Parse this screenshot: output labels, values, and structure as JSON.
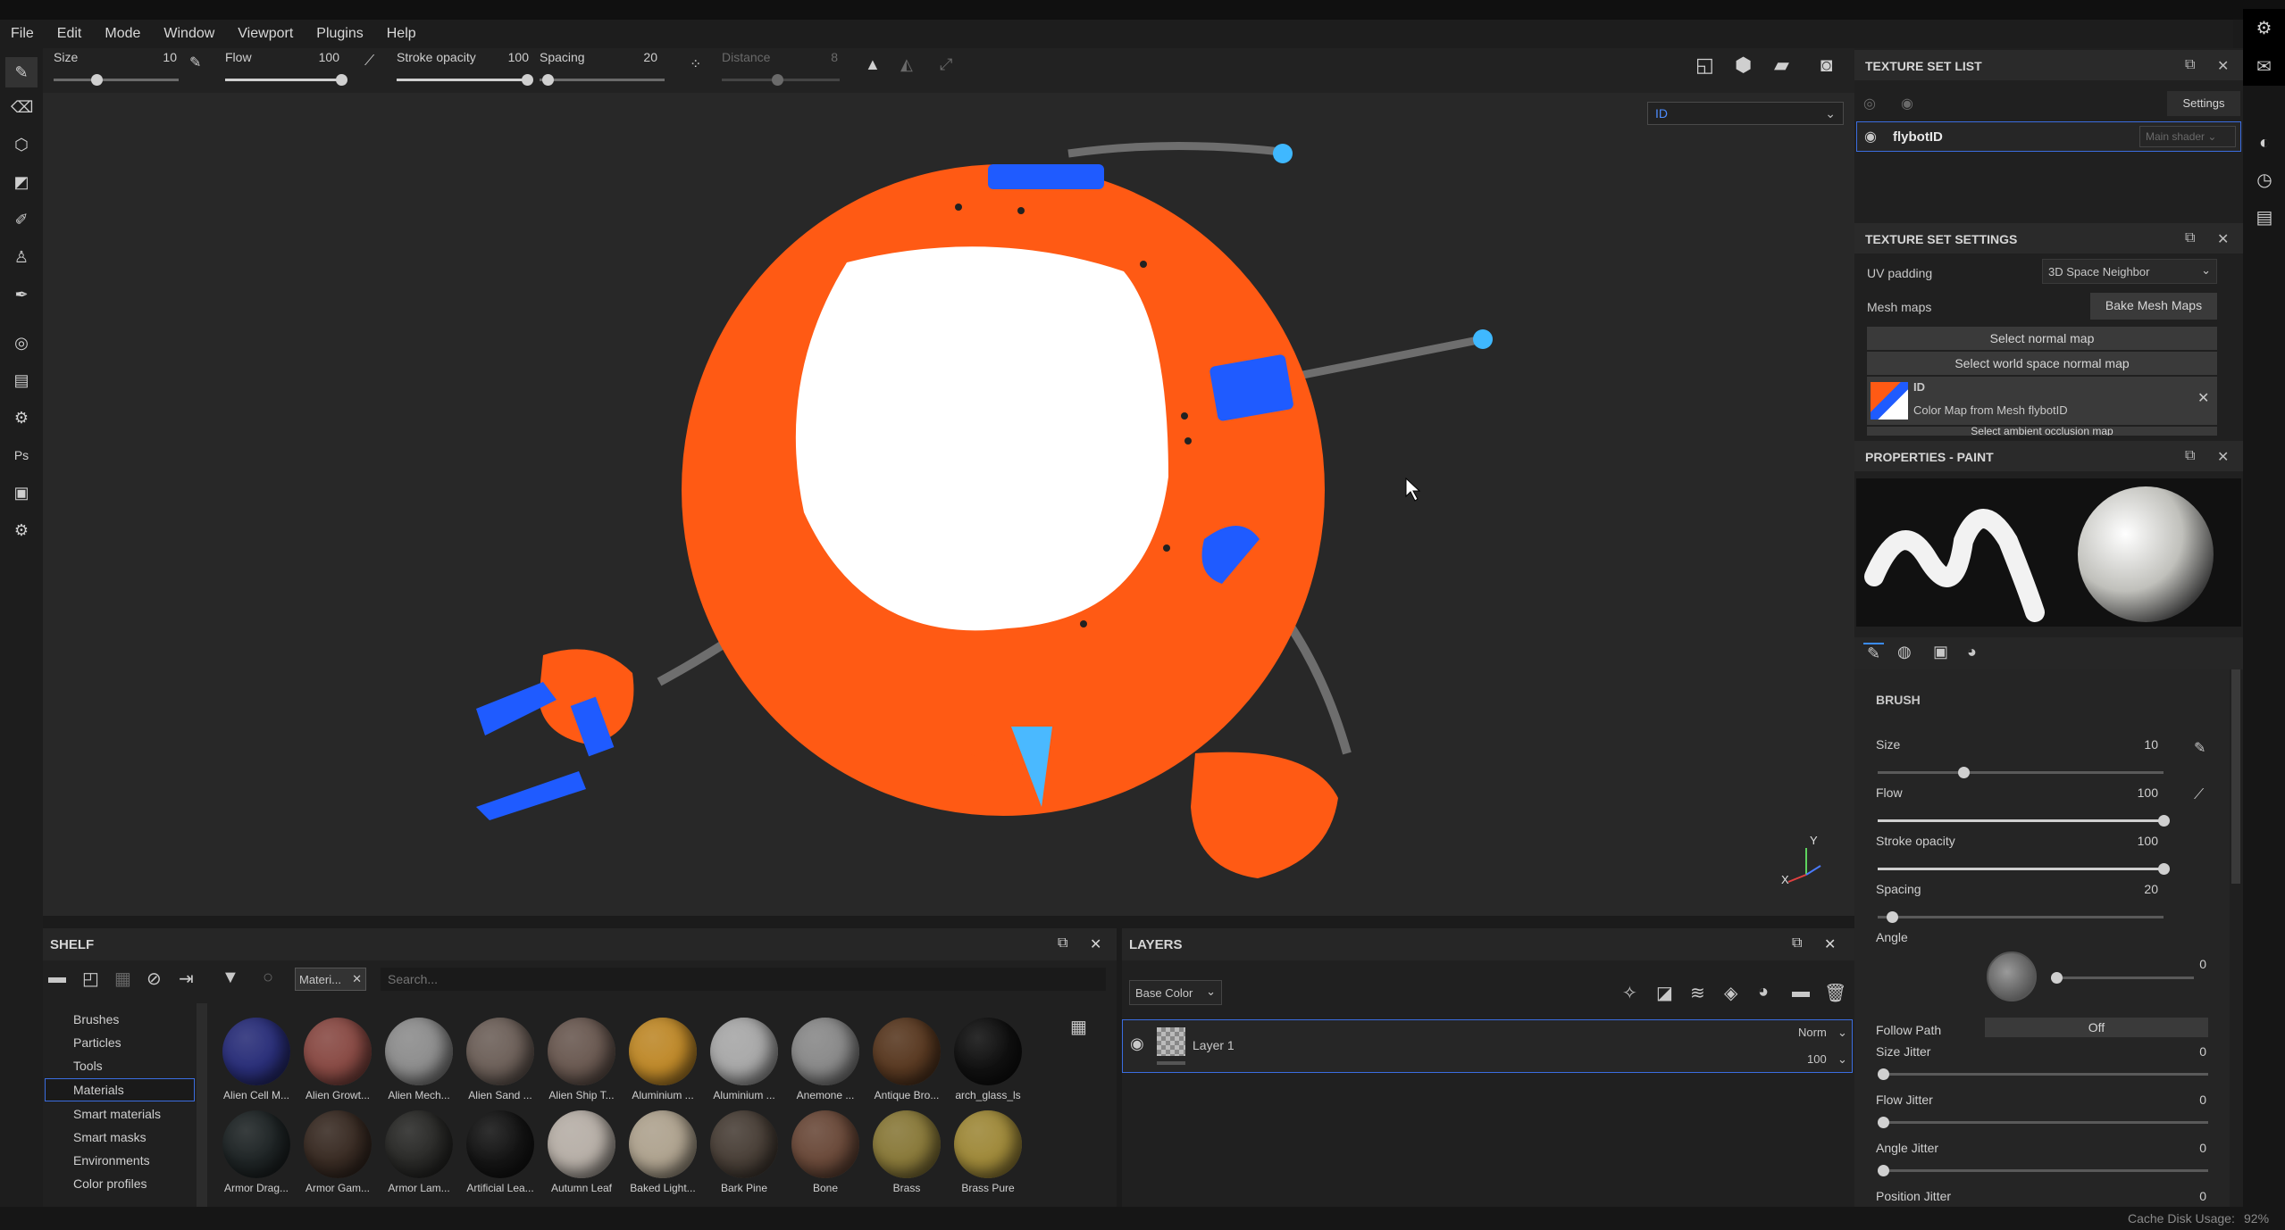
{
  "menu": {
    "items": [
      "File",
      "Edit",
      "Mode",
      "Window",
      "Viewport",
      "Plugins",
      "Help"
    ]
  },
  "toolbar": {
    "size_label": "Size",
    "size_value": "10",
    "flow_label": "Flow",
    "flow_value": "100",
    "stroke_opacity_label": "Stroke opacity",
    "stroke_opacity_value": "100",
    "spacing_label": "Spacing",
    "spacing_value": "20",
    "distance_label": "Distance",
    "distance_value": "8"
  },
  "viewport": {
    "channel_select": "ID",
    "axis_y": "Y",
    "axis_x": "X"
  },
  "texture_set_list": {
    "title": "TEXTURE SET LIST",
    "settings_label": "Settings",
    "item_name": "flybotID",
    "shader": "Main shader"
  },
  "texture_set_settings": {
    "title": "TEXTURE SET SETTINGS",
    "uv_padding_label": "UV padding",
    "uv_padding_value": "3D Space Neighbor",
    "mesh_maps_label": "Mesh maps",
    "bake_button": "Bake Mesh Maps",
    "select_normal": "Select normal map",
    "select_world_normal": "Select world space normal map",
    "map_name": "ID",
    "map_desc": "Color Map from Mesh flybotID",
    "select_ao": "Select ambient occlusion map"
  },
  "properties_paint": {
    "title": "PROPERTIES - PAINT",
    "brush_section": "BRUSH",
    "size_label": "Size",
    "size_value": "10",
    "size_fraction": 0.3,
    "flow_label": "Flow",
    "flow_value": "100",
    "flow_fraction": 1.0,
    "stroke_opacity_label": "Stroke opacity",
    "stroke_opacity_value": "100",
    "stroke_opacity_fraction": 1.0,
    "spacing_label": "Spacing",
    "spacing_value": "20",
    "spacing_fraction": 0.05,
    "angle_label": "Angle",
    "angle_value": "0",
    "follow_path_label": "Follow Path",
    "follow_path_value": "Off",
    "size_jitter_label": "Size Jitter",
    "size_jitter_value": "0",
    "flow_jitter_label": "Flow Jitter",
    "flow_jitter_value": "0",
    "angle_jitter_label": "Angle Jitter",
    "angle_jitter_value": "0",
    "position_jitter_label": "Position Jitter",
    "position_jitter_value": "0"
  },
  "shelf": {
    "title": "SHELF",
    "filter_tag": "Materi...",
    "search_placeholder": "Search...",
    "categories": [
      "Brushes",
      "Particles",
      "Tools",
      "Materials",
      "Smart materials",
      "Smart masks",
      "Environments",
      "Color profiles"
    ],
    "selected_category": "Materials",
    "materials": [
      {
        "name": "Alien Cell M...",
        "color": "#2a2f7a"
      },
      {
        "name": "Alien Growt...",
        "color": "#8a4b45"
      },
      {
        "name": "Alien Mech...",
        "color": "#8e8e8e"
      },
      {
        "name": "Alien Sand ...",
        "color": "#6e615a"
      },
      {
        "name": "Alien Ship T...",
        "color": "#6b5a52"
      },
      {
        "name": "Aluminium ...",
        "color": "#c08a2a"
      },
      {
        "name": "Aluminium ...",
        "color": "#a9a9a9"
      },
      {
        "name": "Anemone ...",
        "color": "#8a8a8a"
      },
      {
        "name": "Antique Bro...",
        "color": "#5a3a22"
      },
      {
        "name": "arch_glass_ls",
        "color": "#111111"
      },
      {
        "name": "Armor Drag...",
        "color": "#1f2526"
      },
      {
        "name": "Armor Gam...",
        "color": "#3a2c24"
      },
      {
        "name": "Armor Lam...",
        "color": "#2a2a28"
      },
      {
        "name": "Artificial Lea...",
        "color": "#151515"
      },
      {
        "name": "Autumn Leaf",
        "color": "#b8b0a8"
      },
      {
        "name": "Baked Light...",
        "color": "#b0a490"
      },
      {
        "name": "Bark Pine",
        "color": "#4a4038"
      },
      {
        "name": "Bone",
        "color": "#6b4a3a"
      },
      {
        "name": "Brass",
        "color": "#8a7a3a"
      },
      {
        "name": "Brass Pure",
        "color": "#a08a3a"
      }
    ]
  },
  "layers": {
    "title": "LAYERS",
    "channel": "Base Color",
    "layer_name": "Layer 1",
    "blend_mode": "Norm",
    "opacity": "100"
  },
  "status": {
    "cache_label": "Cache Disk Usage:",
    "cache_value": "92%"
  }
}
